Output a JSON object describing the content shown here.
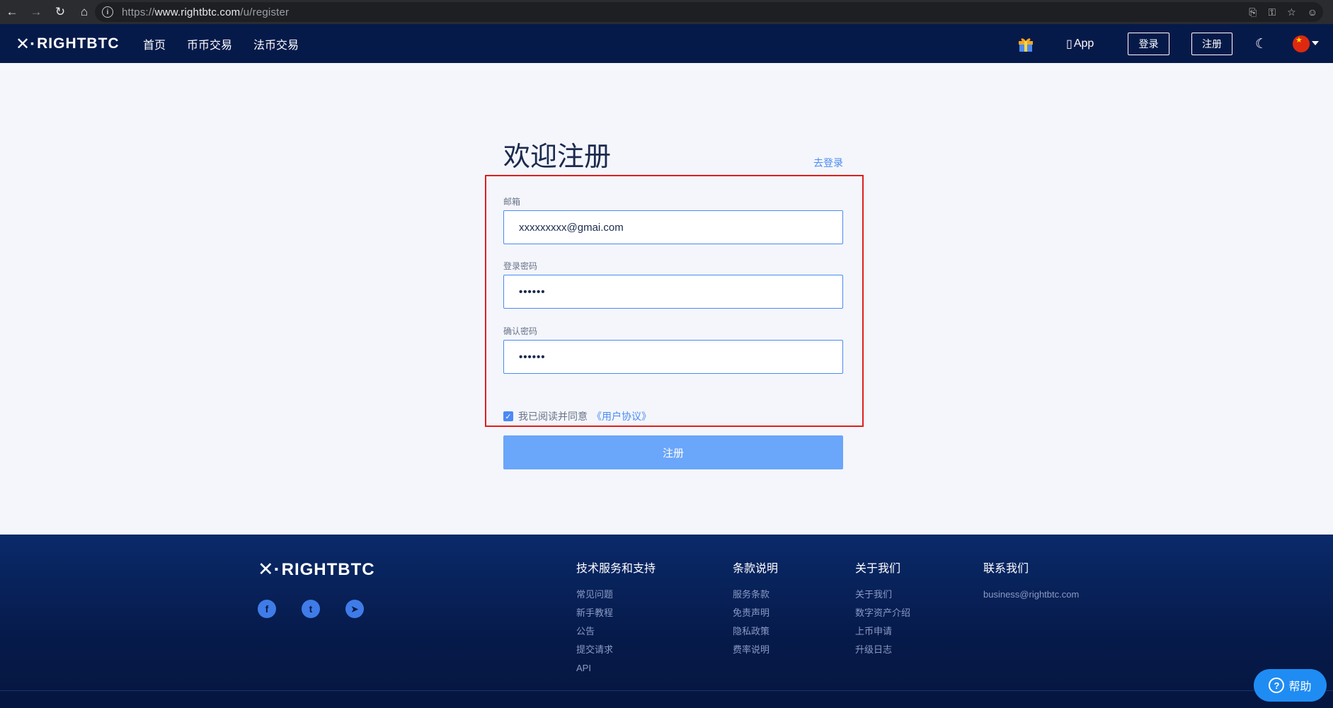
{
  "browser": {
    "url_scheme": "https://",
    "url_host": "www.rightbtc.com",
    "url_path": "/u/register"
  },
  "header": {
    "logo_mark": "✕·",
    "logo_text": "RIGHTBTC",
    "nav": [
      "首页",
      "币币交易",
      "法币交易"
    ],
    "app_label": "App",
    "login_label": "登录",
    "register_label": "注册"
  },
  "form": {
    "title": "欢迎注册",
    "goto_login": "去登录",
    "email_label": "邮箱",
    "email_value": "xxxxxxxxx@gmai.com",
    "password_label": "登录密码",
    "password_value": "••••••",
    "confirm_label": "确认密码",
    "confirm_value": "••••••",
    "agree_text": "我已阅读并同意",
    "agree_link": "《用户协议》",
    "agree_checked": true,
    "submit_label": "注册"
  },
  "footer": {
    "logo_text": "RIGHTBTC",
    "columns": [
      {
        "title": "技术服务和支持",
        "items": [
          "常见问题",
          "新手教程",
          "公告",
          "提交请求",
          "API"
        ]
      },
      {
        "title": "条款说明",
        "items": [
          "服务条款",
          "免责声明",
          "隐私政策",
          "费率说明"
        ]
      },
      {
        "title": "关于我们",
        "items": [
          "关于我们",
          "数字资产介绍",
          "上币申请",
          "升级日志"
        ]
      },
      {
        "title": "联系我们",
        "items": [
          "business@rightbtc.com"
        ]
      }
    ],
    "help_label": "帮助"
  },
  "colors": {
    "header_bg": "#061a4a",
    "accent": "#4a8af4",
    "highlight_border": "#e01e1e",
    "submit_bg": "#6aa6fa"
  }
}
